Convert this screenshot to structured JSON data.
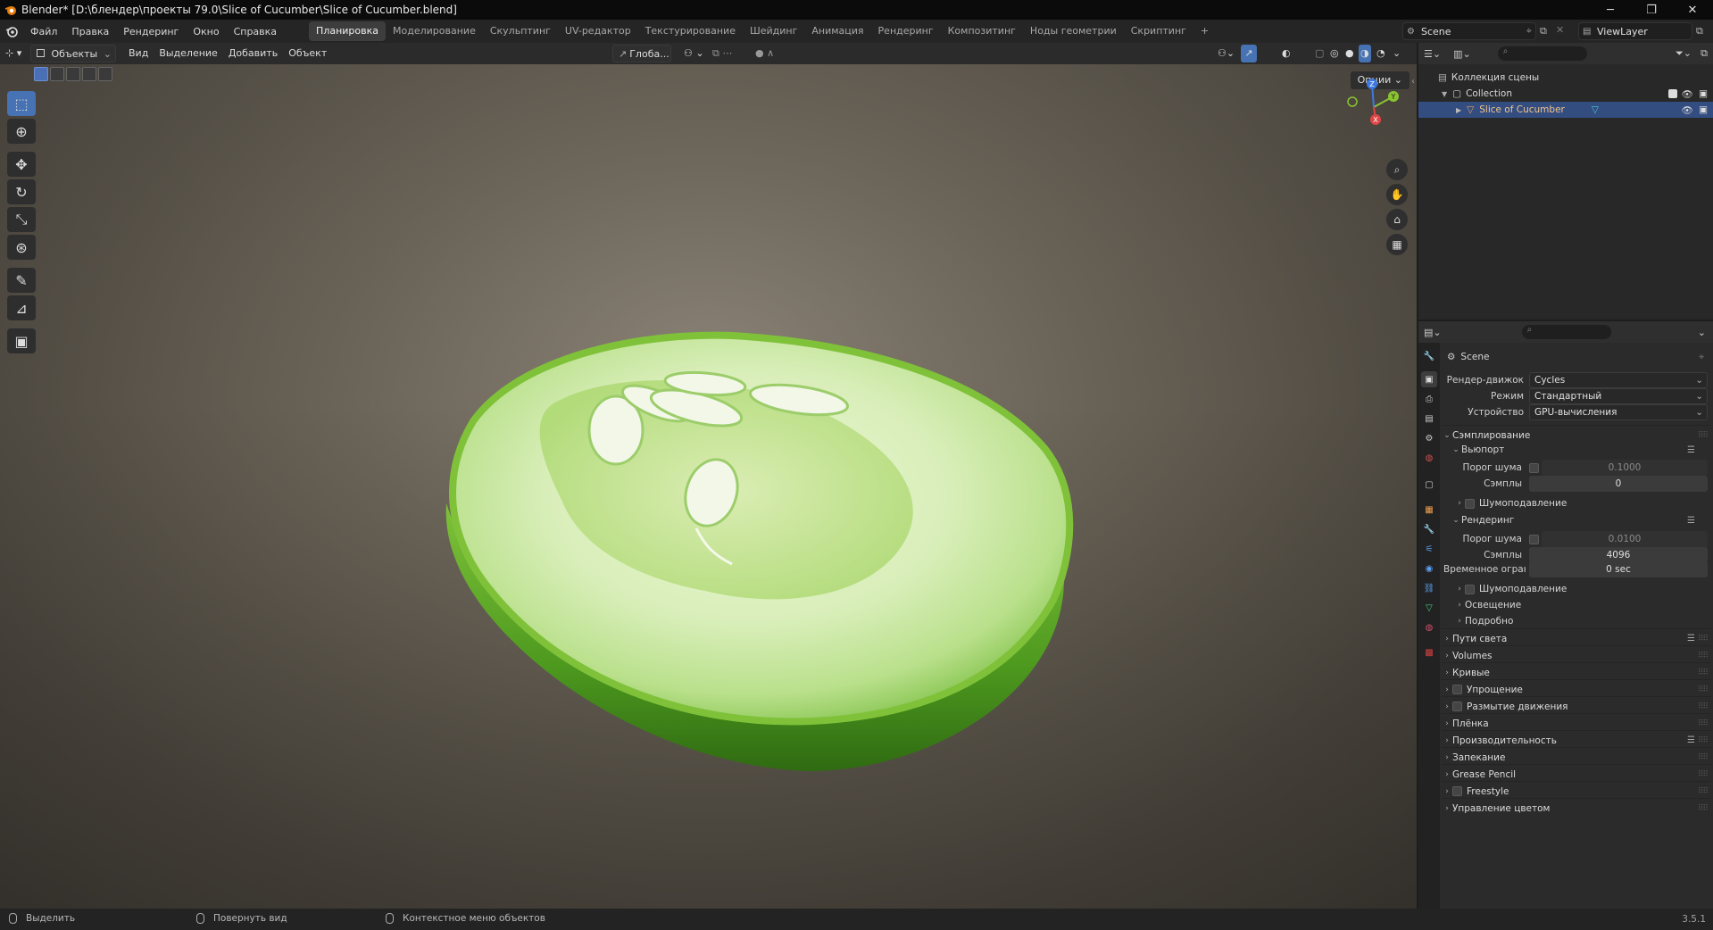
{
  "window": {
    "title": "Blender* [D:\\блендер\\проекты 79.0\\Slice of Cucumber\\Slice of Cucumber.blend]",
    "minimize": "─",
    "maximize": "❐",
    "close": "✕"
  },
  "menu": {
    "items": [
      "Файл",
      "Правка",
      "Рендеринг",
      "Окно",
      "Справка"
    ]
  },
  "workspaces": {
    "active_index": 0,
    "tabs": [
      "Планировка",
      "Моделирование",
      "Скульптинг",
      "UV-редактор",
      "Текстурирование",
      "Шейдинг",
      "Анимация",
      "Рендеринг",
      "Композитинг",
      "Ноды геометрии",
      "Скриптинг"
    ],
    "add": "+"
  },
  "scene_selector": {
    "value": "Scene"
  },
  "viewlayer_selector": {
    "value": "ViewLayer"
  },
  "viewport_header": {
    "mode": "Объекты",
    "menus": [
      "Вид",
      "Выделение",
      "Добавить",
      "Объект"
    ],
    "orientation": "Глоба...",
    "options": "Опции"
  },
  "toolbar": {
    "tools": [
      {
        "name": "select-box",
        "glyph": "⬚",
        "active": true
      },
      {
        "name": "cursor",
        "glyph": "⊕",
        "active": false
      },
      {
        "name": "move",
        "glyph": "✥",
        "active": false
      },
      {
        "name": "rotate",
        "glyph": "↻",
        "active": false
      },
      {
        "name": "scale",
        "glyph": "⤡",
        "active": false
      },
      {
        "name": "transform",
        "glyph": "⊛",
        "active": false
      },
      {
        "name": "annotate",
        "glyph": "✎",
        "active": false
      },
      {
        "name": "measure",
        "glyph": "📐",
        "active": false
      },
      {
        "name": "add-cube",
        "glyph": "▣",
        "active": false
      }
    ]
  },
  "gizmo": {
    "x": "X",
    "y": "Y",
    "z": "Z"
  },
  "outliner": {
    "root": "Коллекция сцены",
    "collection": "Collection",
    "object": "Slice of Cucumber"
  },
  "properties": {
    "context": "Scene",
    "render_engine_label": "Рендер-движок",
    "render_engine": "Cycles",
    "mode_label": "Режим",
    "mode": "Стандартный",
    "device_label": "Устройство",
    "device": "GPU-вычисления",
    "sampling": "Сэмплирование",
    "viewport": "Вьюпорт",
    "noise_threshold_label": "Порог шума",
    "viewport_noise_threshold": "0.1000",
    "samples_label": "Сэмплы",
    "viewport_samples": "0",
    "denoise": "Шумоподавление",
    "render": "Рендеринг",
    "render_noise_threshold": "0.0100",
    "render_samples": "4096",
    "time_limit_label": "Временное огранич...",
    "time_limit": "0 sec",
    "lighting": "Освещение",
    "advanced": "Подробно",
    "sections": [
      "Пути света",
      "Volumes",
      "Кривые",
      "Упрощение",
      "Размытие движения",
      "Плёнка",
      "Производительность",
      "Запекание",
      "Grease Pencil",
      "Freestyle",
      "Управление цветом"
    ]
  },
  "statusbar": {
    "select": "Выделить",
    "rotate_view": "Повернуть вид",
    "context_menu": "Контекстное меню объектов",
    "version": "3.5.1"
  },
  "colors": {
    "accent": "#4772b3",
    "selected_row": "#334d80",
    "cucumber_flesh": "#d7ecb5",
    "cucumber_skin": "#4f9a1f"
  }
}
